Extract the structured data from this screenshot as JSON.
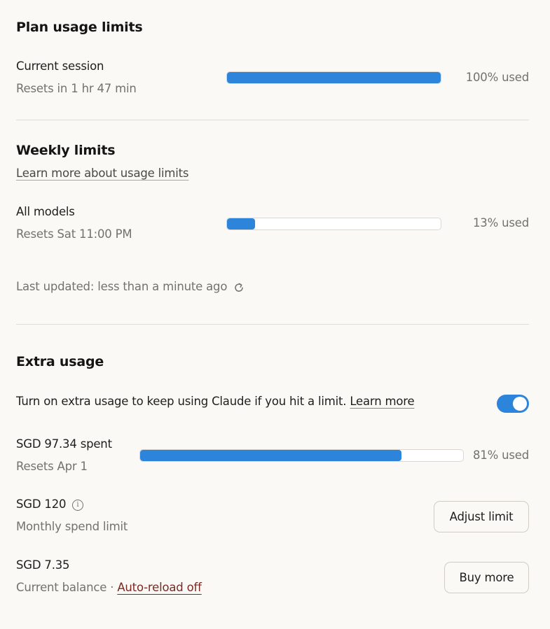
{
  "plan": {
    "title": "Plan usage limits",
    "session": {
      "label": "Current session",
      "resets": "Resets in 1 hr 47 min",
      "percent": 100,
      "used_text": "100% used"
    }
  },
  "weekly": {
    "title": "Weekly limits",
    "learn_link": "Learn more about usage limits",
    "all_models": {
      "label": "All models",
      "resets": "Resets Sat 11:00 PM",
      "percent": 13,
      "used_text": "13% used"
    },
    "last_updated": "Last updated: less than a minute ago",
    "refresh_icon": "refresh-icon"
  },
  "extra": {
    "title": "Extra usage",
    "description": "Turn on extra usage to keep using Claude if you hit a limit.",
    "learn_more": "Learn more",
    "toggle_on": true,
    "spent": {
      "label": "SGD 97.34 spent",
      "resets": "Resets Apr 1",
      "percent": 81,
      "used_text": "81% used"
    },
    "limit": {
      "amount": "SGD 120",
      "label": "Monthly spend limit",
      "info_icon": "info-icon",
      "button": "Adjust limit"
    },
    "balance": {
      "amount": "SGD 7.35",
      "label": "Current balance",
      "separator": "·",
      "auto_reload": "Auto-reload off",
      "button": "Buy more"
    }
  },
  "colors": {
    "accent": "#2c84db",
    "background": "#faf9f5",
    "muted_text": "#73726c",
    "link_red": "#7a2a22"
  }
}
